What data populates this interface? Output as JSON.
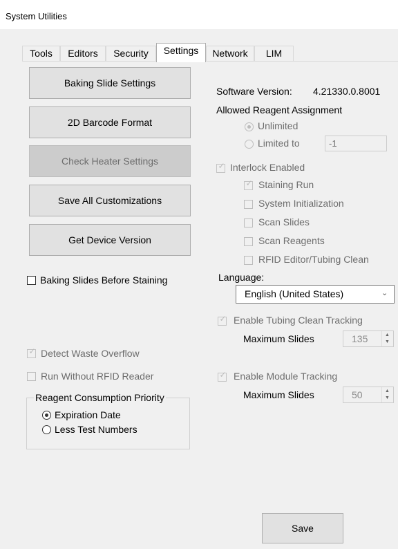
{
  "window": {
    "title": "System Utilities"
  },
  "tabs": [
    {
      "label": "Tools",
      "active": false
    },
    {
      "label": "Editors",
      "active": false
    },
    {
      "label": "Security",
      "active": false
    },
    {
      "label": "Settings",
      "active": true
    },
    {
      "label": "Network",
      "active": false
    },
    {
      "label": "LIM",
      "active": false
    }
  ],
  "left": {
    "buttons": {
      "baking": "Baking Slide Settings",
      "barcode": "2D Barcode Format",
      "heater": "Check Heater Settings",
      "save_custom": "Save All Customizations",
      "device": "Get Device Version"
    },
    "baking_before_staining": {
      "label": "Baking Slides Before Staining",
      "checked": false
    },
    "detect_waste": {
      "label": "Detect Waste Overflow",
      "checked": true,
      "disabled": true
    },
    "run_without_rfid": {
      "label": "Run Without RFID Reader",
      "checked": false,
      "disabled": true
    },
    "priority": {
      "title": "Reagent Consumption Priority",
      "options": [
        {
          "label": "Expiration Date",
          "selected": true
        },
        {
          "label": "Less Test Numbers",
          "selected": false
        }
      ]
    }
  },
  "right": {
    "software_version_label": "Software Version:",
    "software_version_value": "4.21330.0.8001",
    "allowed_reagent_label": "Allowed Reagent Assignment",
    "unlimited_label": "Unlimited",
    "limited_label": "Limited to",
    "limited_value": "-1",
    "interlock": {
      "label": "Interlock Enabled",
      "items": [
        {
          "label": "Staining Run",
          "checked": true
        },
        {
          "label": "System Initialization",
          "checked": false
        },
        {
          "label": "Scan Slides",
          "checked": false
        },
        {
          "label": "Scan Reagents",
          "checked": false
        },
        {
          "label": "RFID Editor/Tubing Clean",
          "checked": false
        }
      ]
    },
    "language_label": "Language:",
    "language_value": "English (United States)",
    "tubing_tracking_label": "Enable Tubing Clean Tracking",
    "tubing_max_label": "Maximum Slides",
    "tubing_max_value": "135",
    "module_tracking_label": "Enable Module Tracking",
    "module_max_label": "Maximum Slides",
    "module_max_value": "50"
  },
  "save_label": "Save"
}
